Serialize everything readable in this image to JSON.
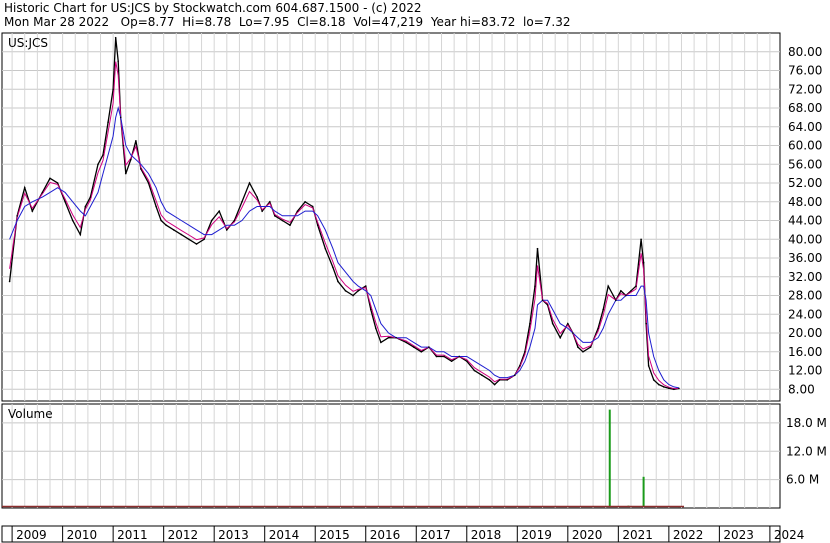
{
  "header": {
    "line1": "Historic Chart for US:JCS by Stockwatch.com 604.687.1500 - (c) 2022",
    "line2": "Mon Mar 28 2022   Op=8.77  Hi=8.78  Lo=7.95  Cl=8.18  Vol=47,219  Year hi=83.72  lo=7.32"
  },
  "chart_data": [
    {
      "type": "line",
      "title": "US:JCS",
      "xlabel": "",
      "ylabel": "",
      "grid": true,
      "ylim": [
        5.5,
        84
      ],
      "ytick_labels": [
        "80.00",
        "76.00",
        "72.00",
        "68.00",
        "64.00",
        "60.00",
        "56.00",
        "52.00",
        "48.00",
        "44.00",
        "40.00",
        "36.00",
        "32.00",
        "28.00",
        "24.00",
        "20.00",
        "16.00",
        "12.00",
        "8.00"
      ],
      "ytick_values": [
        80,
        76,
        72,
        68,
        64,
        60,
        56,
        52,
        48,
        44,
        40,
        36,
        32,
        28,
        24,
        20,
        16,
        12,
        8
      ],
      "x_labels": [
        "2009",
        "2010",
        "2011",
        "2012",
        "2013",
        "2014",
        "2015",
        "2016",
        "2017",
        "2018",
        "2019",
        "2020",
        "2021",
        "2022",
        "2023",
        "2024"
      ],
      "colors": {
        "price": "#000000",
        "ma_short": "#d0007f",
        "ma_long": "#1f1fd0"
      },
      "series": [
        {
          "x": [
            2008.95,
            2009.1,
            2009.25,
            2009.4,
            2009.6,
            2009.75,
            2009.9,
            2010.05,
            2010.2,
            2010.35,
            2010.45,
            2010.55,
            2010.7,
            2010.8,
            2010.9,
            2011.0,
            2011.05,
            2011.1,
            2011.15,
            2011.2,
            2011.25,
            2011.35,
            2011.45,
            2011.55,
            2011.7,
            2011.85,
            2011.95,
            2012.05,
            2012.2,
            2012.35,
            2012.5,
            2012.65,
            2012.8,
            2012.95,
            2013.1,
            2013.25,
            2013.4,
            2013.55,
            2013.7,
            2013.85,
            2013.95,
            2014.1,
            2014.2,
            2014.35,
            2014.5,
            2014.65,
            2014.8,
            2014.95,
            2015.05,
            2015.2,
            2015.35,
            2015.45,
            2015.6,
            2015.75,
            2015.85,
            2016.0,
            2016.1,
            2016.2,
            2016.3,
            2016.45,
            2016.6,
            2016.8,
            2016.95,
            2017.1,
            2017.25,
            2017.4,
            2017.55,
            2017.7,
            2017.85,
            2018.0,
            2018.15,
            2018.3,
            2018.45,
            2018.55,
            2018.65,
            2018.8,
            2018.95,
            2019.05,
            2019.15,
            2019.25,
            2019.35,
            2019.4,
            2019.5,
            2019.6,
            2019.7,
            2019.85,
            2020.0,
            2020.1,
            2020.2,
            2020.3,
            2020.45,
            2020.6,
            2020.7,
            2020.8,
            2020.9,
            2020.95,
            2021.05,
            2021.15,
            2021.25,
            2021.35,
            2021.45,
            2021.5,
            2021.55,
            2021.6,
            2021.7,
            2021.8,
            2021.9,
            2022.0,
            2022.1,
            2022.2
          ],
          "y": [
            31,
            45,
            51,
            46,
            50,
            53,
            52,
            48,
            44,
            41,
            47,
            49,
            56,
            58,
            65,
            72,
            83,
            78,
            66,
            60,
            54,
            57,
            61,
            55,
            52,
            47,
            44,
            43,
            42,
            41,
            40,
            39,
            40,
            44,
            46,
            42,
            44,
            48,
            52,
            49,
            46,
            48,
            45,
            44,
            43,
            46,
            48,
            47,
            43,
            38,
            34,
            31,
            29,
            28,
            29,
            30,
            25,
            21,
            18,
            19,
            19,
            18,
            17,
            16,
            17,
            15,
            15,
            14,
            15,
            14,
            12,
            11,
            10,
            9,
            10,
            10,
            11,
            13,
            16,
            22,
            30,
            38,
            27,
            26,
            22,
            19,
            22,
            20,
            17,
            16,
            17,
            21,
            25,
            30,
            28,
            27,
            29,
            28,
            29,
            30,
            40,
            35,
            22,
            13,
            10,
            9,
            8.5,
            8.2,
            8.0,
            8.18
          ],
          "name": ""
        }
      ],
      "ma_long_y": [
        40,
        44,
        47,
        48,
        49,
        50,
        51,
        50,
        48,
        46,
        45,
        47,
        50,
        54,
        58,
        62,
        66,
        68,
        66,
        63,
        60,
        58,
        57,
        56,
        54,
        51,
        48,
        46,
        45,
        44,
        43,
        42,
        41,
        41,
        42,
        43,
        43,
        44,
        46,
        47,
        47,
        47,
        46,
        45,
        45,
        45,
        46,
        46,
        45,
        42,
        38,
        35,
        33,
        31,
        30,
        29,
        28,
        25,
        22,
        20,
        19,
        19,
        18,
        17,
        17,
        16,
        16,
        15,
        15,
        15,
        14,
        13,
        12,
        11,
        10.5,
        10.5,
        11,
        12,
        14,
        17,
        21,
        26,
        27,
        27,
        25,
        22,
        21,
        20,
        19,
        18,
        18,
        19,
        21,
        24,
        26,
        27,
        27,
        28,
        28,
        28,
        30,
        30,
        27,
        20,
        15,
        12,
        10,
        9,
        8.5,
        8.3
      ]
    },
    {
      "type": "bar",
      "title": "Volume",
      "ytick_labels": [
        "18.0 M",
        "12.0 M",
        "6.0 M"
      ],
      "ytick_values": [
        18,
        12,
        6
      ],
      "ylim": [
        0,
        22
      ],
      "x": [
        2009.0,
        2009.5,
        2010.0,
        2010.5,
        2011.0,
        2011.5,
        2012.0,
        2012.5,
        2013.0,
        2013.5,
        2014.0,
        2014.5,
        2015.0,
        2015.5,
        2016.0,
        2016.5,
        2017.0,
        2017.5,
        2018.0,
        2018.5,
        2019.0,
        2019.5,
        2020.0,
        2020.5,
        2020.83,
        2021.2,
        2021.5,
        2021.8,
        2022.0,
        2022.2
      ],
      "values": [
        0.3,
        0.3,
        0.2,
        0.3,
        0.4,
        0.3,
        0.2,
        0.2,
        0.2,
        0.2,
        0.2,
        0.2,
        0.2,
        0.2,
        0.3,
        0.2,
        0.2,
        0.2,
        0.2,
        0.2,
        0.3,
        0.3,
        0.3,
        0.4,
        20.8,
        0.5,
        6.6,
        0.4,
        0.3,
        0.2
      ]
    }
  ]
}
